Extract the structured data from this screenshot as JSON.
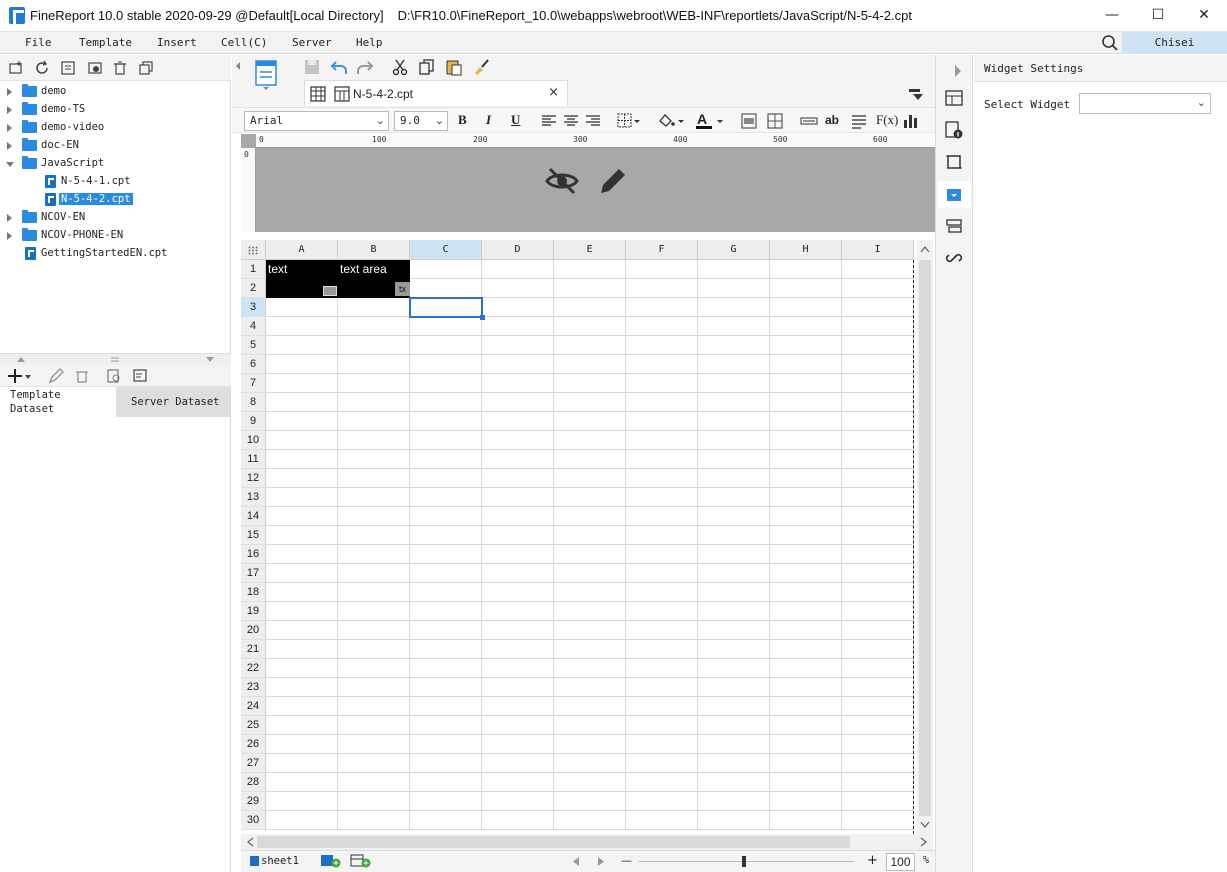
{
  "window": {
    "title": "FineReport 10.0 stable 2020-09-29 @Default[Local Directory]",
    "path": "D:\\FR10.0\\FineReport_10.0\\webapps\\webroot\\WEB-INF\\reportlets/JavaScript/N-5-4-2.cpt",
    "minimize": "—",
    "maximize": "☐",
    "close": "✕"
  },
  "menu": {
    "items": [
      "File",
      "Template",
      "Insert",
      "Cell(C)",
      "Server",
      "Help"
    ],
    "user": "Chisei"
  },
  "tree": {
    "items": [
      {
        "label": "demo",
        "type": "folder"
      },
      {
        "label": "demo-TS",
        "type": "folder"
      },
      {
        "label": "demo-video",
        "type": "folder"
      },
      {
        "label": "doc-EN",
        "type": "folder"
      },
      {
        "label": "JavaScript",
        "type": "folder-open"
      },
      {
        "label": "N-5-4-1.cpt",
        "type": "file"
      },
      {
        "label": "N-5-4-2.cpt",
        "type": "file-selected"
      },
      {
        "label": "NCOV-EN",
        "type": "folder"
      },
      {
        "label": "NCOV-PHONE-EN",
        "type": "folder"
      },
      {
        "label": "GettingStartedEN.cpt",
        "type": "file-root"
      }
    ]
  },
  "dataset": {
    "tabs": [
      {
        "line1": "Template",
        "line2": "Dataset"
      },
      {
        "line1": "Server Dataset",
        "line2": ""
      }
    ]
  },
  "editor": {
    "tab_label": "N-5-4-2.cpt",
    "tab_close": "×"
  },
  "format": {
    "font": "Arial",
    "size": "9.0",
    "bold": "B",
    "italic": "I",
    "underline": "U",
    "strike": "ab",
    "formula": "F(x)"
  },
  "ruler": {
    "marks": [
      "0",
      "100",
      "200",
      "300",
      "400",
      "500",
      "600"
    ],
    "vmark": "0"
  },
  "grid": {
    "columns": [
      "A",
      "B",
      "C",
      "D",
      "E",
      "F",
      "G",
      "H",
      "I"
    ],
    "rows": [
      "1",
      "2",
      "3",
      "4",
      "5",
      "6",
      "7",
      "8",
      "9",
      "10",
      "11",
      "12",
      "13",
      "14",
      "15",
      "16",
      "17",
      "18",
      "19",
      "20",
      "21",
      "22",
      "23",
      "24",
      "25",
      "26",
      "27",
      "28",
      "29",
      "30"
    ],
    "selected_col": "C",
    "selected_row": "3",
    "cells": {
      "a1": "text",
      "b1": "text area",
      "b2_tag": "tx"
    }
  },
  "status": {
    "sheet": "sheet1",
    "zoom": "100",
    "zoom_unit": "%",
    "minus": "—",
    "plus": "+"
  },
  "widget_panel": {
    "title": "Widget Settings",
    "select_label": "Select Widget",
    "select_value": ""
  }
}
